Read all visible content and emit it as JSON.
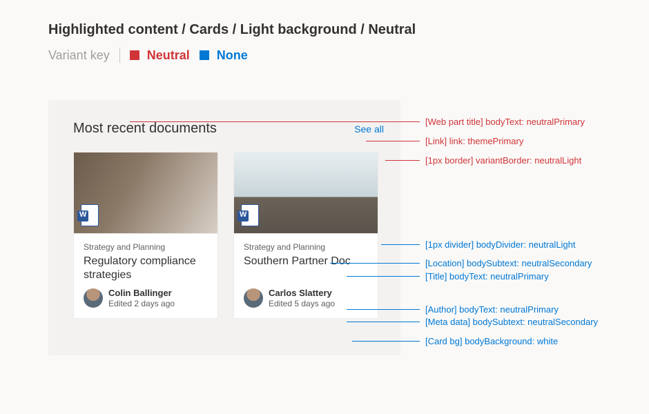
{
  "header": {
    "breadcrumb": "Highlighted content / Cards / Light background / Neutral",
    "variant_key_label": "Variant key",
    "variants": {
      "neutral": "Neutral",
      "none": "None"
    }
  },
  "panel": {
    "title": "Most recent documents",
    "see_all": "See all"
  },
  "cards": [
    {
      "location": "Strategy and Planning",
      "title": "Regulatory compliance strategies",
      "author": "Colin Ballinger",
      "meta": "Edited 2 days ago",
      "doc_type": "word"
    },
    {
      "location": "Strategy and Planning",
      "title": "Southern Partner Doc",
      "author": "Carlos Slattery",
      "meta": "Edited 5 days ago",
      "doc_type": "word"
    }
  ],
  "annotations": {
    "red": [
      {
        "text": "[Web part title] bodyText: neutralPrimary"
      },
      {
        "text": "[Link] link: themePrimary"
      },
      {
        "text": "[1px border] variantBorder: neutralLight"
      }
    ],
    "blue": [
      {
        "text": "[1px divider] bodyDivider: neutralLight"
      },
      {
        "text": "[Location] bodySubtext: neutralSecondary"
      },
      {
        "text": "[Title] bodyText: neutralPrimary"
      },
      {
        "text": "[Author] bodyText: neutralPrimary"
      },
      {
        "text": "[Meta data] bodySubtext: neutralSecondary"
      },
      {
        "text": "[Card bg] bodyBackground: white"
      }
    ]
  },
  "colors": {
    "neutralPrimary": "#323130",
    "neutralSecondary": "#605e5c",
    "neutralLight": "#edebe9",
    "themePrimary": "#0078d4",
    "red": "#d13438",
    "white": "#ffffff"
  }
}
